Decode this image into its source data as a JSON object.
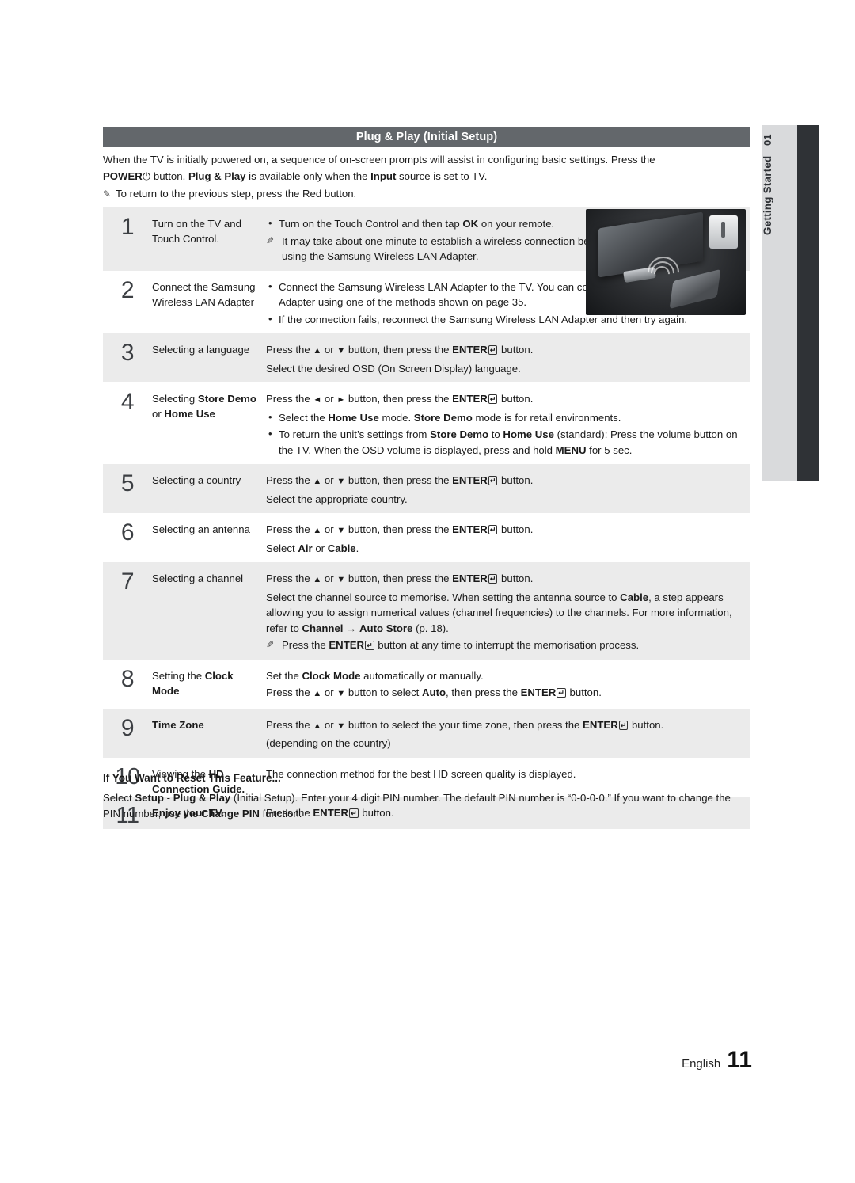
{
  "sidetab": {
    "number": "01",
    "label": "Getting Started"
  },
  "header": {
    "title": "Plug & Play (Initial Setup)"
  },
  "intro": {
    "line1_a": "When the TV is initially powered on, a sequence of on-screen prompts will assist in configuring basic settings. Press the",
    "line2_power": "POWER",
    "line2_symbol": "⏻",
    "line2_b": " button. ",
    "line2_pp": "Plug & Play",
    "line2_c": " is available only when the ",
    "line2_input": "Input",
    "line2_d": " source is set to TV.",
    "note": "To return to the previous step, press the Red button."
  },
  "steps": [
    {
      "num": "1",
      "title_parts": [
        {
          "t": "Turn on the TV and Touch Control.",
          "b": false
        }
      ],
      "body": [
        {
          "type": "bullet",
          "parts": [
            {
              "t": "Turn on the Touch Control and then tap ",
              "b": false
            },
            {
              "t": "OK",
              "b": true
            },
            {
              "t": " on your remote.",
              "b": false
            }
          ]
        },
        {
          "type": "note",
          "parts": [
            {
              "t": "It may take about one minute to establish a wireless connection between the TV and Touch Control using the Samsung Wireless LAN Adapter.",
              "b": false
            }
          ]
        }
      ]
    },
    {
      "num": "2",
      "title_parts": [
        {
          "t": "Connect the Samsung Wireless LAN Adapter",
          "b": false
        }
      ],
      "body": [
        {
          "type": "bullet",
          "parts": [
            {
              "t": "Connect the Samsung Wireless LAN Adapter to the TV. You can connect the Samsung Wireless LAN Adapter using one of the methods shown on page 35.",
              "b": false
            }
          ]
        },
        {
          "type": "bullet",
          "parts": [
            {
              "t": "If the connection fails, reconnect the Samsung Wireless LAN Adapter and then try again.",
              "b": false
            }
          ]
        }
      ]
    },
    {
      "num": "3",
      "title_parts": [
        {
          "t": "Selecting a language",
          "b": false
        }
      ],
      "body": [
        {
          "type": "plain",
          "parts": [
            {
              "t": "Press the ",
              "b": false
            },
            {
              "t": "▲",
              "b": false,
              "arrow": true
            },
            {
              "t": " or ",
              "b": false
            },
            {
              "t": "▼",
              "b": false,
              "arrow": true
            },
            {
              "t": " button, then press the ",
              "b": false
            },
            {
              "t": "ENTER",
              "b": true
            },
            {
              "t": "↵",
              "b": false,
              "key": true
            },
            {
              "t": " button.",
              "b": false
            }
          ]
        },
        {
          "type": "plain",
          "parts": [
            {
              "t": "Select the desired OSD (On Screen Display) language.",
              "b": false
            }
          ]
        }
      ]
    },
    {
      "num": "4",
      "title_parts": [
        {
          "t": "Selecting ",
          "b": false
        },
        {
          "t": "Store Demo",
          "b": true
        },
        {
          "t": " or ",
          "b": false
        },
        {
          "t": "Home Use",
          "b": true
        }
      ],
      "body": [
        {
          "type": "plain",
          "parts": [
            {
              "t": "Press the ",
              "b": false
            },
            {
              "t": "◄",
              "b": false,
              "arrow": true
            },
            {
              "t": " or ",
              "b": false
            },
            {
              "t": "►",
              "b": false,
              "arrow": true
            },
            {
              "t": " button, then press the ",
              "b": false
            },
            {
              "t": "ENTER",
              "b": true
            },
            {
              "t": "↵",
              "b": false,
              "key": true
            },
            {
              "t": " button.",
              "b": false
            }
          ]
        },
        {
          "type": "bullet",
          "parts": [
            {
              "t": "Select the ",
              "b": false
            },
            {
              "t": "Home Use",
              "b": true
            },
            {
              "t": " mode. ",
              "b": false
            },
            {
              "t": "Store Demo",
              "b": true
            },
            {
              "t": " mode is for retail environments.",
              "b": false
            }
          ]
        },
        {
          "type": "bullet",
          "parts": [
            {
              "t": "To return the unit’s settings from ",
              "b": false
            },
            {
              "t": "Store Demo",
              "b": true
            },
            {
              "t": " to ",
              "b": false
            },
            {
              "t": "Home Use",
              "b": true
            },
            {
              "t": " (standard): Press the volume button on the TV. When the OSD volume is displayed, press and hold ",
              "b": false
            },
            {
              "t": "MENU",
              "b": true
            },
            {
              "t": " for 5 sec.",
              "b": false
            }
          ]
        }
      ]
    },
    {
      "num": "5",
      "title_parts": [
        {
          "t": "Selecting a country",
          "b": false
        }
      ],
      "body": [
        {
          "type": "plain",
          "parts": [
            {
              "t": "Press the ",
              "b": false
            },
            {
              "t": "▲",
              "b": false,
              "arrow": true
            },
            {
              "t": " or ",
              "b": false
            },
            {
              "t": "▼",
              "b": false,
              "arrow": true
            },
            {
              "t": " button, then press the ",
              "b": false
            },
            {
              "t": "ENTER",
              "b": true
            },
            {
              "t": "↵",
              "b": false,
              "key": true
            },
            {
              "t": " button.",
              "b": false
            }
          ]
        },
        {
          "type": "plain",
          "parts": [
            {
              "t": "Select the appropriate country.",
              "b": false
            }
          ]
        }
      ]
    },
    {
      "num": "6",
      "title_parts": [
        {
          "t": "Selecting an antenna",
          "b": false
        }
      ],
      "body": [
        {
          "type": "plain",
          "parts": [
            {
              "t": "Press the ",
              "b": false
            },
            {
              "t": "▲",
              "b": false,
              "arrow": true
            },
            {
              "t": " or ",
              "b": false
            },
            {
              "t": "▼",
              "b": false,
              "arrow": true
            },
            {
              "t": " button, then press the ",
              "b": false
            },
            {
              "t": "ENTER",
              "b": true
            },
            {
              "t": "↵",
              "b": false,
              "key": true
            },
            {
              "t": " button.",
              "b": false
            }
          ]
        },
        {
          "type": "plain",
          "parts": [
            {
              "t": "Select ",
              "b": false
            },
            {
              "t": "Air",
              "b": true
            },
            {
              "t": " or ",
              "b": false
            },
            {
              "t": "Cable",
              "b": true
            },
            {
              "t": ".",
              "b": false
            }
          ]
        }
      ]
    },
    {
      "num": "7",
      "title_parts": [
        {
          "t": "Selecting a channel",
          "b": false
        }
      ],
      "body": [
        {
          "type": "plain",
          "parts": [
            {
              "t": "Press the ",
              "b": false
            },
            {
              "t": "▲",
              "b": false,
              "arrow": true
            },
            {
              "t": " or ",
              "b": false
            },
            {
              "t": "▼",
              "b": false,
              "arrow": true
            },
            {
              "t": " button, then press the ",
              "b": false
            },
            {
              "t": "ENTER",
              "b": true
            },
            {
              "t": "↵",
              "b": false,
              "key": true
            },
            {
              "t": " button.",
              "b": false
            }
          ]
        },
        {
          "type": "plain",
          "parts": [
            {
              "t": "Select the channel source to memorise. When setting the antenna source to ",
              "b": false
            },
            {
              "t": "Cable",
              "b": true
            },
            {
              "t": ", a step appears allowing you to assign numerical values (channel frequencies) to the channels. For more information, refer to ",
              "b": false
            },
            {
              "t": "Channel",
              "b": true
            },
            {
              "t": " → ",
              "b": false
            },
            {
              "t": "Auto Store",
              "b": true
            },
            {
              "t": " (p. 18).",
              "b": false
            }
          ]
        },
        {
          "type": "note",
          "parts": [
            {
              "t": "Press the ",
              "b": false
            },
            {
              "t": "ENTER",
              "b": true
            },
            {
              "t": "↵",
              "b": false,
              "key": true
            },
            {
              "t": " button at any time to interrupt the memorisation process.",
              "b": false
            }
          ]
        }
      ]
    },
    {
      "num": "8",
      "title_parts": [
        {
          "t": "Setting the ",
          "b": false
        },
        {
          "t": "Clock Mode",
          "b": true
        }
      ],
      "body": [
        {
          "type": "plain",
          "parts": [
            {
              "t": "Set the ",
              "b": false
            },
            {
              "t": "Clock Mode",
              "b": true
            },
            {
              "t": " automatically or manually.",
              "b": false
            }
          ]
        },
        {
          "type": "plain",
          "parts": [
            {
              "t": "Press the ",
              "b": false
            },
            {
              "t": "▲",
              "b": false,
              "arrow": true
            },
            {
              "t": " or ",
              "b": false
            },
            {
              "t": "▼",
              "b": false,
              "arrow": true
            },
            {
              "t": " button to select ",
              "b": false
            },
            {
              "t": "Auto",
              "b": true
            },
            {
              "t": ", then press the ",
              "b": false
            },
            {
              "t": "ENTER",
              "b": true
            },
            {
              "t": "↵",
              "b": false,
              "key": true
            },
            {
              "t": " button.",
              "b": false
            }
          ]
        }
      ]
    },
    {
      "num": "9",
      "title_parts": [
        {
          "t": "Time Zone",
          "b": true
        }
      ],
      "body": [
        {
          "type": "plain",
          "parts": [
            {
              "t": "Press the ",
              "b": false
            },
            {
              "t": "▲",
              "b": false,
              "arrow": true
            },
            {
              "t": " or ",
              "b": false
            },
            {
              "t": "▼",
              "b": false,
              "arrow": true
            },
            {
              "t": " button to select the your time zone, then press the ",
              "b": false
            },
            {
              "t": "ENTER",
              "b": true
            },
            {
              "t": "↵",
              "b": false,
              "key": true
            },
            {
              "t": " button.",
              "b": false
            }
          ]
        },
        {
          "type": "plain",
          "parts": [
            {
              "t": "(depending on the country)",
              "b": false
            }
          ]
        }
      ]
    },
    {
      "num": "10",
      "title_parts": [
        {
          "t": "Viewing the ",
          "b": false
        },
        {
          "t": "HD Connection Guide.",
          "b": true
        }
      ],
      "body": [
        {
          "type": "plain",
          "parts": [
            {
              "t": "The connection method for the best HD screen quality is displayed.",
              "b": false
            }
          ]
        }
      ]
    },
    {
      "num": "11",
      "title_parts": [
        {
          "t": "Enjoy your TV.",
          "b": true
        }
      ],
      "body": [
        {
          "type": "plain",
          "parts": [
            {
              "t": "Press the ",
              "b": false
            },
            {
              "t": "ENTER",
              "b": true
            },
            {
              "t": "↵",
              "b": false,
              "key": true
            },
            {
              "t": " button.",
              "b": false
            }
          ]
        }
      ]
    }
  ],
  "reset": {
    "title": "If You Want to Reset This Feature...",
    "parts": [
      {
        "t": "Select ",
        "b": false
      },
      {
        "t": "Setup",
        "b": true
      },
      {
        "t": " - ",
        "b": false
      },
      {
        "t": "Plug & Play",
        "b": true
      },
      {
        "t": " (Initial Setup). Enter your 4 digit PIN number. The default PIN number is “0-0-0-0.” If you want to change the PIN number, use the ",
        "b": false
      },
      {
        "t": "Change PIN",
        "b": true
      },
      {
        "t": " function.",
        "b": false
      }
    ]
  },
  "footer": {
    "language": "English",
    "page": "11"
  }
}
